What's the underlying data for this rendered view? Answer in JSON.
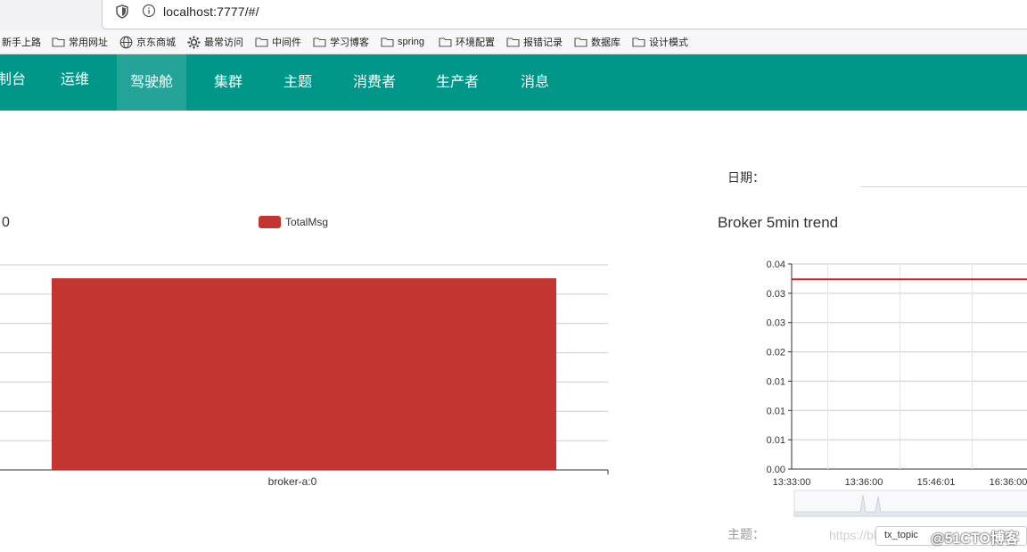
{
  "browser": {
    "url": "localhost:7777/#/",
    "bookmarks": [
      "新手上路",
      "常用网址",
      "京东商城",
      "最常访问",
      "中间件",
      "学习博客",
      "spring",
      "环境配置",
      "报错记录",
      "数据库",
      "设计模式"
    ]
  },
  "nav": {
    "brand": "制台",
    "items": [
      "运维",
      "驾驶舱",
      "集群",
      "主题",
      "消费者",
      "生产者",
      "消息"
    ],
    "active": "驾驶舱"
  },
  "broker_chart": {
    "title": "0",
    "legend": "TotalMsg"
  },
  "trend_panel": {
    "date_label": "日期：",
    "date_value": "",
    "title": "Broker 5min trend",
    "topic_label": "主题：",
    "topic_value": "tx_topic"
  },
  "watermark": {
    "url": "https://blo",
    "text": "@51CTO博客"
  },
  "colors": {
    "nav": "#009688",
    "bar": "#c23531",
    "line": "#d01f1f"
  },
  "chart_data": [
    {
      "type": "bar",
      "title": "0",
      "categories": [
        "broker-a:0"
      ],
      "series": [
        {
          "name": "TotalMsg",
          "values": [
            1
          ]
        }
      ],
      "ylim": [
        0,
        1.07
      ],
      "grid": true,
      "legend_position": "top-center"
    },
    {
      "type": "line",
      "title": "Broker 5min trend",
      "x_ticks": [
        "13:33:00",
        "13:36:00",
        "15:46:01",
        "16:36:00"
      ],
      "y_ticks": [
        "0.00",
        "0.01",
        "0.01",
        "0.01",
        "0.02",
        "0.03",
        "0.03",
        "0.04"
      ],
      "ylim": [
        0,
        0.04
      ],
      "series": [
        {
          "values": [
            0.037,
            0.037,
            0.037,
            0.037
          ]
        }
      ],
      "grid": true
    }
  ]
}
